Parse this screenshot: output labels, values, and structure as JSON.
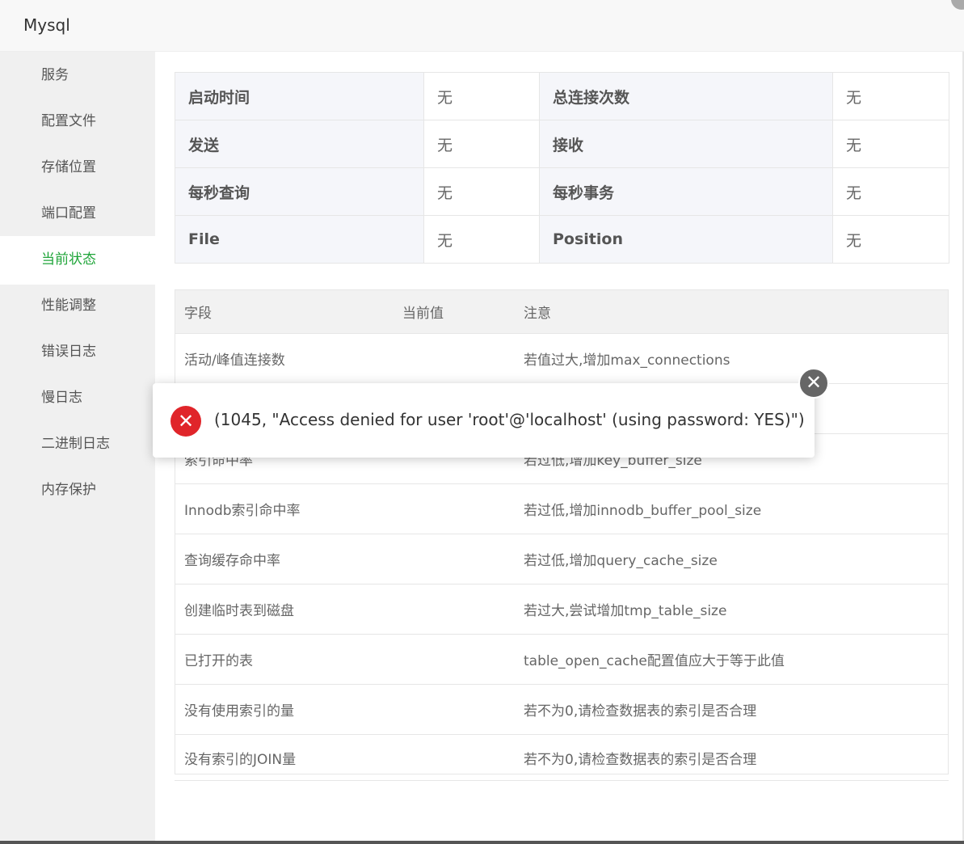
{
  "window": {
    "title": "Mysql"
  },
  "sidebar": {
    "items": [
      {
        "label": "服务"
      },
      {
        "label": "配置文件"
      },
      {
        "label": "存储位置"
      },
      {
        "label": "端口配置"
      },
      {
        "label": "当前状态",
        "active": true
      },
      {
        "label": "性能调整"
      },
      {
        "label": "错误日志"
      },
      {
        "label": "慢日志"
      },
      {
        "label": "二进制日志"
      },
      {
        "label": "内存保护"
      }
    ]
  },
  "status_table": {
    "rows": [
      {
        "k1": "启动时间",
        "v1": "无",
        "k2": "总连接次数",
        "v2": "无"
      },
      {
        "k1": "发送",
        "v1": "无",
        "k2": "接收",
        "v2": "无"
      },
      {
        "k1": "每秒查询",
        "v1": "无",
        "k2": "每秒事务",
        "v2": "无"
      },
      {
        "k1": "File",
        "v1": "无",
        "k2": "Position",
        "v2": "无"
      }
    ]
  },
  "var_table": {
    "headers": [
      "字段",
      "当前值",
      "注意"
    ],
    "rows": [
      {
        "field": "活动/峰值连接数",
        "value": "",
        "note": "若值过大,增加max_connections"
      },
      {
        "field": "",
        "value": "",
        "note": ""
      },
      {
        "field": "索引命中率",
        "value": "",
        "note": "若过低,增加key_buffer_size"
      },
      {
        "field": "Innodb索引命中率",
        "value": "",
        "note": "若过低,增加innodb_buffer_pool_size"
      },
      {
        "field": "查询缓存命中率",
        "value": "",
        "note": "若过低,增加query_cache_size"
      },
      {
        "field": "创建临时表到磁盘",
        "value": "",
        "note": "若过大,尝试增加tmp_table_size"
      },
      {
        "field": "已打开的表",
        "value": "",
        "note": "table_open_cache配置值应大于等于此值"
      },
      {
        "field": "没有使用索引的量",
        "value": "",
        "note": "若不为0,请检查数据表的索引是否合理"
      },
      {
        "field": "没有索引的JOIN量",
        "value": "",
        "note": "若不为0,请检查数据表的索引是否合理"
      }
    ]
  },
  "toast": {
    "icon": "error-icon",
    "message": "(1045, \"Access denied for user 'root'@'localhost' (using password: YES)\")",
    "close_icon": "close-icon"
  },
  "colors": {
    "accent": "#20a53a",
    "error": "#e0252a"
  }
}
